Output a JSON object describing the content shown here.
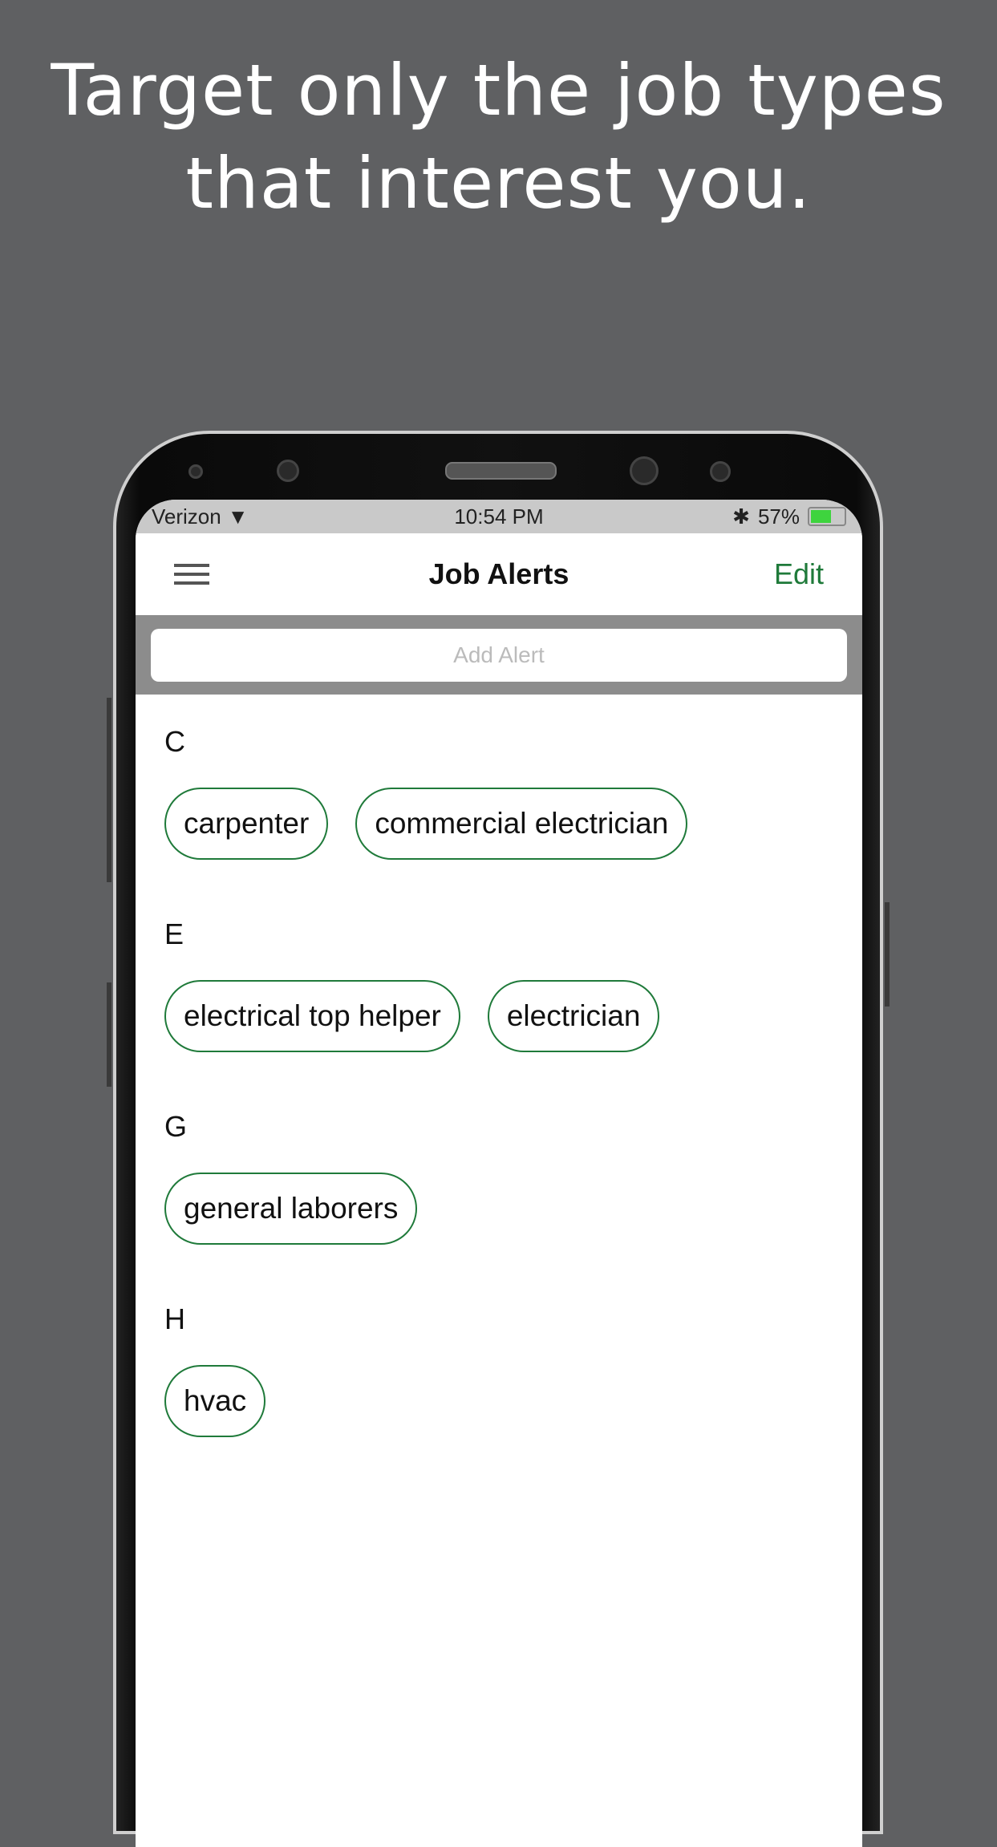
{
  "headline": {
    "line1": "Target only the job types",
    "line2": "that interest you."
  },
  "status_bar": {
    "carrier": "Verizon",
    "time": "10:54 PM",
    "battery": "57%",
    "battery_level": 0.57
  },
  "nav": {
    "title": "Job Alerts",
    "edit_label": "Edit",
    "menu_icon": "hamburger-icon"
  },
  "search": {
    "placeholder": "Add Alert",
    "value": ""
  },
  "colors": {
    "accent": "#1f7a3a",
    "background": "#5f6062"
  },
  "sections": [
    {
      "letter": "C",
      "chips": [
        "carpenter",
        "commercial electrician"
      ]
    },
    {
      "letter": "E",
      "chips": [
        "electrical top helper",
        "electrician"
      ]
    },
    {
      "letter": "G",
      "chips": [
        "general laborers"
      ]
    },
    {
      "letter": "H",
      "chips": [
        "hvac"
      ]
    }
  ]
}
